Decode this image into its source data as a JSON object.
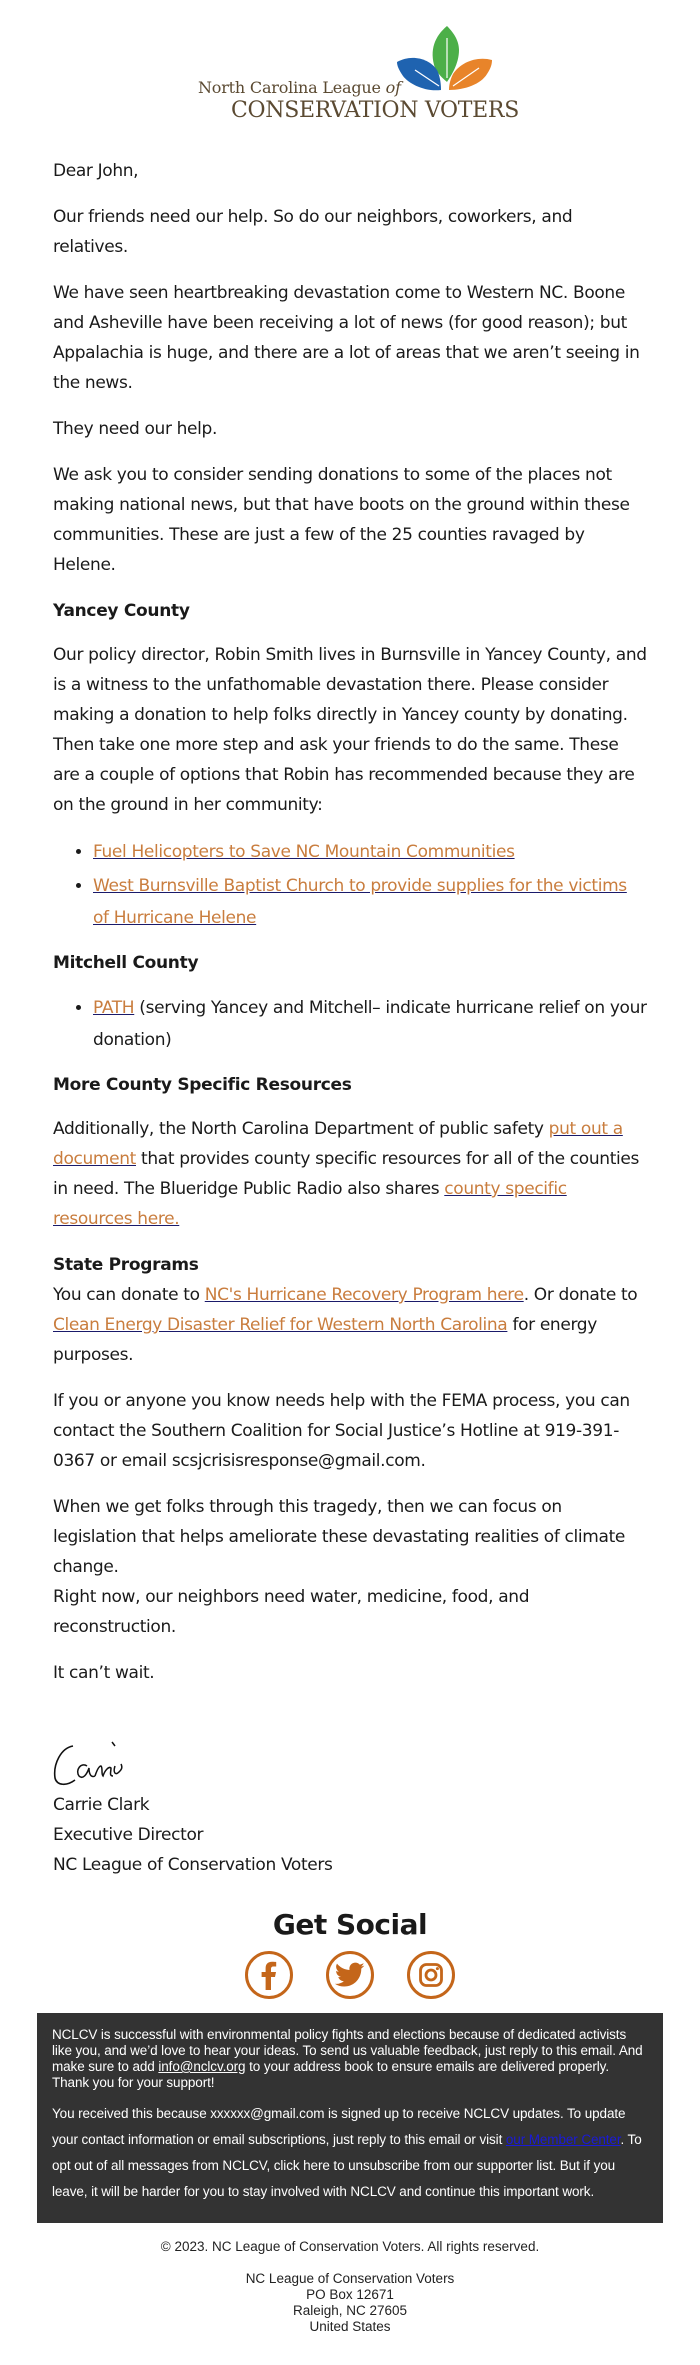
{
  "logo": {
    "line1": "North Carolina League",
    "line1_of": "of",
    "line2": "CONSERVATION VOTERS",
    "colors": {
      "green": "#4caf48",
      "blue": "#1f63b0",
      "orange": "#e8842a",
      "text": "#5b4a32"
    }
  },
  "greeting": "Dear John,",
  "paragraphs": {
    "p1": "Our friends need our help. So do our neighbors, coworkers, and relatives.",
    "p2": "We have seen heartbreaking devastation come to Western NC. Boone and Asheville have been receiving a lot of news (for good reason); but Appalachia is huge, and there are a lot of areas that we aren’t seeing in the news.",
    "p3": "They need our help.",
    "p4": "We ask you to consider sending donations to some of the places not making national news, but that have boots on the ground within these communities. These are just a few of the 25 counties ravaged by Helene."
  },
  "yancey": {
    "heading": "Yancey County",
    "body": "Our policy director, Robin Smith lives in Burnsville in Yancey County, and is a witness to the unfathomable devastation there. Please consider making a donation to help folks directly in Yancey county by donating. Then take one more step and ask your friends to do the same. These are a couple of options that Robin has recommended because they are on the ground in her community:",
    "links": [
      "Fuel Helicopters to Save NC Mountain Communities",
      "West Burnsville Baptist Church to provide supplies for the victims of Hurricane Helene"
    ]
  },
  "mitchell": {
    "heading": "Mitchell County",
    "link": "PATH",
    "after": " (serving Yancey and Mitchell– indicate hurricane relief on your donation)"
  },
  "resources": {
    "heading": "More County Specific Resources",
    "t1": "Additionally, the North Carolina Department of public safety ",
    "link1": "put out a document",
    "t2": " that provides county specific resources for all of the counties in need. The Blueridge Public Radio also shares ",
    "link2": "county specific resources here."
  },
  "state": {
    "heading": "State Programs",
    "t1": "You can donate to ",
    "link1": "NC's Hurricane Recovery Program here",
    "t2": ". Or donate to ",
    "link2": "Clean Energy Disaster Relief for Western North Carolina",
    "t3": " for energy purposes."
  },
  "fema": "If you or anyone you know needs help with the FEMA process, you can contact the Southern Coalition for Social Justice’s Hotline at 919-391-0367 or email scsjcrisisresponse@gmail.com.",
  "closing1": "When we get folks through this tragedy, then we can focus on legislation that helps ameliorate these devastating realities of climate change.",
  "closing2": "Right now, our neighbors need water, medicine, food, and reconstruction.",
  "closing3": "It can’t wait.",
  "signature": {
    "name": "Carrie Clark",
    "title": "Executive Director",
    "org": "NC League of Conservation Voters"
  },
  "social": {
    "title": "Get Social",
    "icons": [
      "facebook-icon",
      "twitter-icon",
      "instagram-icon"
    ],
    "color": "#c4661a"
  },
  "dark_box": {
    "p1_a": "NCLCV is successful with environmental policy fights and elections because of dedicated activists like you, and we’d love to hear your ideas. To send us valuable feedback, just reply to this email. And make sure to add ",
    "p1_link": "info@nclcv.org",
    "p1_b": " to your address book to ensure emails are delivered properly. Thank you for your support!",
    "p2_a": "You received this because xxxxxx@gmail.com is signed up to receive NCLCV updates. To update your contact information or email subscriptions, just reply to this email or visit ",
    "p2_link": "our Member Center",
    "p2_b": ". To opt out of all messages from NCLCV, click here to unsubscribe from our supporter list. ",
    "p2_c": "But if you leave, it will be harder for you to stay involved with NCLCV and continue this important work."
  },
  "footer": {
    "copyright": "© 2023. NC League of Conservation Voters. All rights reserved.",
    "address": [
      "NC League of Conservation Voters",
      "PO Box 12671",
      "Raleigh, NC 27605",
      "United States"
    ]
  }
}
